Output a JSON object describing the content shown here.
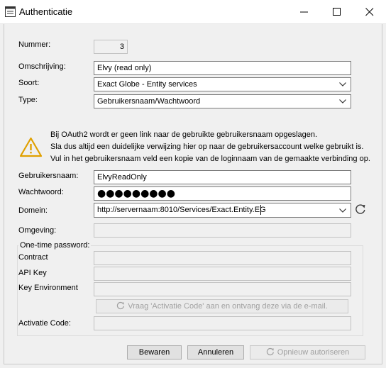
{
  "window": {
    "title": "Authenticatie",
    "controls": [
      "minimize-icon",
      "maximize-icon",
      "close-icon"
    ]
  },
  "fields": {
    "nummer": {
      "label": "Nummer:",
      "value": "3"
    },
    "omschrijving": {
      "label": "Omschrijving:",
      "value": "Elvy (read only)"
    },
    "soort": {
      "label": "Soort:",
      "value": "Exact Globe - Entity services"
    },
    "type": {
      "label": "Type:",
      "value": "Gebruikersnaam/Wachtwoord"
    },
    "gebruikersnaam": {
      "label": "Gebruikersnaam:",
      "value": "ElvyReadOnly"
    },
    "wachtwoord": {
      "label": "Wachtwoord:",
      "value": "●●●●●●●●●"
    },
    "domein": {
      "label": "Domein:",
      "value": "http://servernaam:8010/Services/Exact.Entity.EG"
    },
    "omgeving": {
      "label": "Omgeving:",
      "value": ""
    }
  },
  "warning": {
    "icon": "warning-icon",
    "lines": [
      "Bij OAuth2 wordt er geen link naar de gebruikte gebruikersnaam opgeslagen.",
      "Sla dus altijd een duidelijke verwijzing hier op naar de gebruikersaccount welke gebruikt is.",
      "Vul in het gebruikersnaam veld een kopie van de loginnaam van de gemaakte verbinding op."
    ]
  },
  "otp": {
    "legend": "One-time password:",
    "contract_label": "Contract",
    "apikey_label": "API Key",
    "keyenv_label": "Key Environment",
    "request_button": "Vraag 'Activatie Code' aan en ontvang deze via de e-mail.",
    "activatie_label": "Activatie Code:"
  },
  "footer": {
    "save": "Bewaren",
    "cancel": "Annuleren",
    "reauth": "Opnieuw autoriseren"
  }
}
